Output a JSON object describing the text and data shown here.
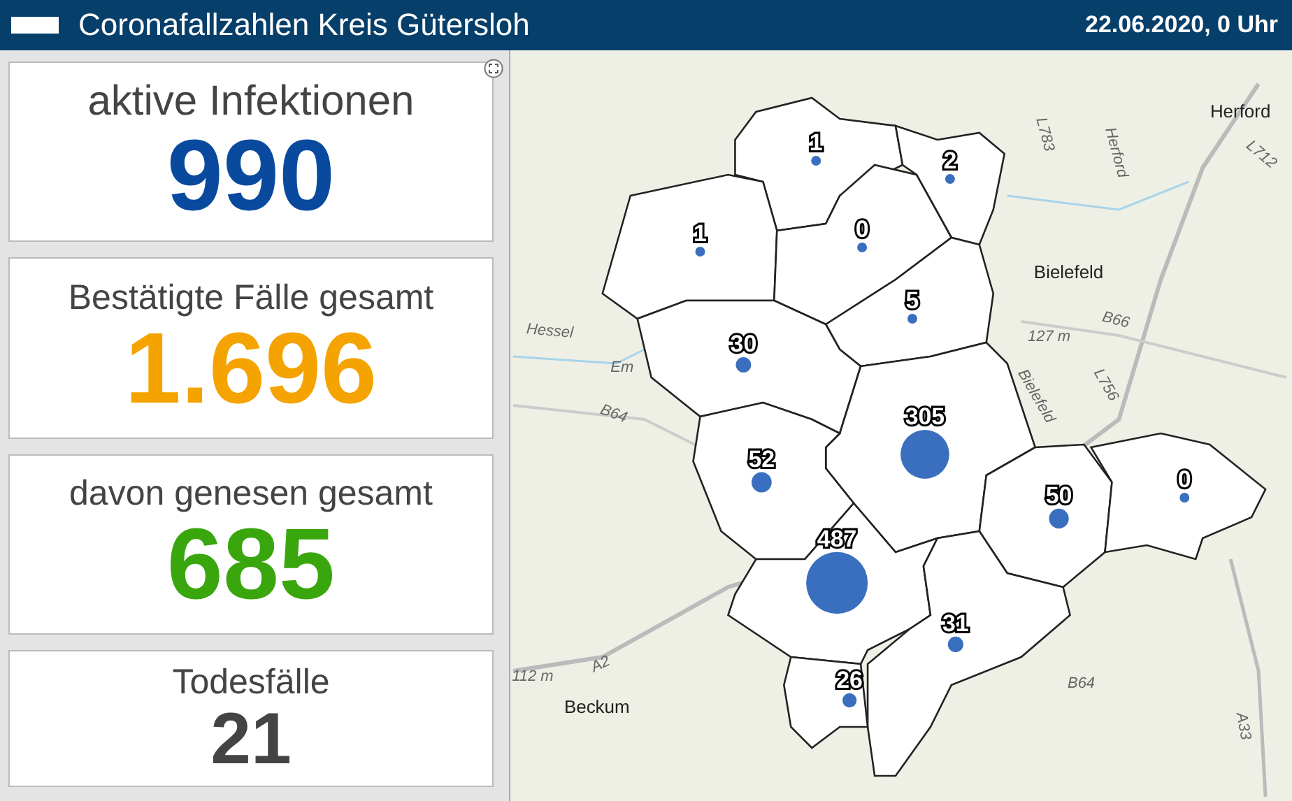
{
  "header": {
    "title": "Coronafallzahlen Kreis Gütersloh",
    "date": "22.06.2020, 0 Uhr"
  },
  "indicators": [
    {
      "label": "aktive Infektionen",
      "value": "990",
      "color": "#0a4a9e",
      "kind": "large"
    },
    {
      "label": "Bestätigte Fälle gesamt",
      "value": "1.696",
      "color": "#f5a300",
      "kind": "large"
    },
    {
      "label": "davon genesen gesamt",
      "value": "685",
      "color": "#3aa60e",
      "kind": "large"
    },
    {
      "label": "Todesfälle",
      "value": "21",
      "color": "#444444",
      "kind": "small"
    }
  ],
  "map": {
    "districts": [
      {
        "cases": "1"
      },
      {
        "cases": "2"
      },
      {
        "cases": "1"
      },
      {
        "cases": "0"
      },
      {
        "cases": "5"
      },
      {
        "cases": "30"
      },
      {
        "cases": "305"
      },
      {
        "cases": "52"
      },
      {
        "cases": "50"
      },
      {
        "cases": "0"
      },
      {
        "cases": "487"
      },
      {
        "cases": "31"
      },
      {
        "cases": "26"
      }
    ],
    "place_labels": [
      "Herford",
      "Herford",
      "L783",
      "L712",
      "Bielefeld",
      "127 m",
      "B66",
      "L756",
      "Bielefeld",
      "Hessel",
      "Em",
      "B64",
      "A2",
      "112 m",
      "Beckum",
      "A33",
      "B64"
    ]
  }
}
